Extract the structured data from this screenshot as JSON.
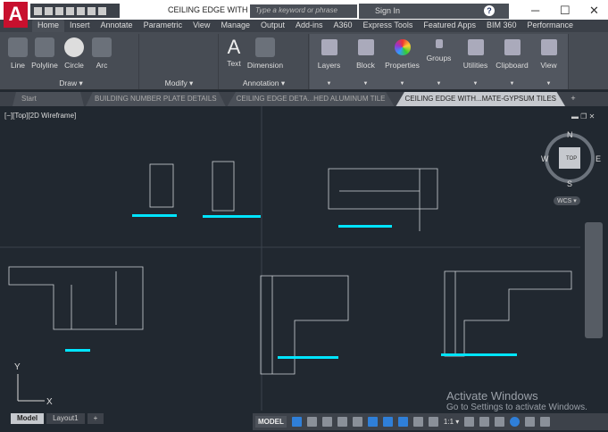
{
  "app": {
    "logo_letter": "A",
    "doc_title": "CEILING EDGE WITH ...",
    "search_placeholder": "Type a keyword or phrase",
    "sign_in": "Sign In",
    "help": "?"
  },
  "window_controls": {
    "minimize": "─",
    "maximize": "☐",
    "close": "✕"
  },
  "ribbon_tabs": [
    "Home",
    "Insert",
    "Annotate",
    "Parametric",
    "View",
    "Manage",
    "Output",
    "Add-ins",
    "A360",
    "Express Tools",
    "Featured Apps",
    "BIM 360",
    "Performance"
  ],
  "draw": {
    "title": "Draw ▾",
    "tools": [
      "Line",
      "Polyline",
      "Circle",
      "Arc"
    ]
  },
  "modify": {
    "title": "Modify ▾"
  },
  "annotation": {
    "title": "Annotation ▾",
    "tools": [
      "Text",
      "Dimension"
    ]
  },
  "panels": [
    "Layers",
    "Block",
    "Properties",
    "Groups",
    "Utilities",
    "Clipboard",
    "View"
  ],
  "doc_tabs": [
    "Start",
    "BUILDING NUMBER PLATE DETAILS",
    "CEILING EDGE DETA...HED ALUMINUM TILE",
    "CEILING EDGE WITH...MATE-GYPSUM TILES"
  ],
  "active_doc_tab": 3,
  "viewport_label": "[−][Top][2D Wireframe]",
  "viewcube": {
    "n": "N",
    "s": "S",
    "e": "E",
    "w": "W",
    "face": "TOP",
    "wcs": "WCS ▾"
  },
  "ucs": {
    "x": "X",
    "y": "Y"
  },
  "layout_tabs": [
    "Model",
    "Layout1",
    "+"
  ],
  "status": {
    "model": "MODEL",
    "scale": "1:1 ▾"
  },
  "watermark": {
    "line1": "Activate Windows",
    "line2": "Go to Settings to activate Windows."
  },
  "colors": {
    "accent_cyan": "#00e5ff",
    "canvas": "#212830",
    "logo_red": "#c8102e"
  }
}
